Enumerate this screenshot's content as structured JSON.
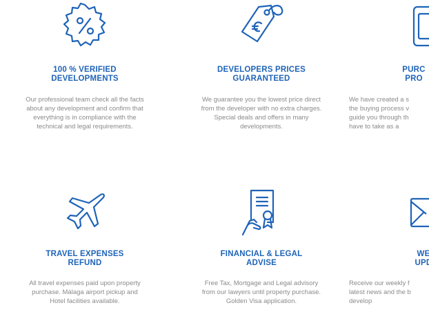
{
  "features": [
    {
      "icon": "percent-badge-icon",
      "title": "100 % VERIFIED\nDEVELOPMENTS",
      "description": "Our professional team check all the facts\nabout any development and confirm that\neverything is in compliance with the\ntechnical  and legal requirements."
    },
    {
      "icon": "euro-price-tag-icon",
      "title": "DEVELOPERS PRICES\nGUARANTEED",
      "description": "We guarantee you the lowest price direct\nfrom the developer with no extra charges.\nSpecial deals and offers in many\ndevelopments."
    },
    {
      "icon": "tablet-icon",
      "title": "PURC\nPRO",
      "description": "We have created a s\nthe buying process v\nguide you through th\nhave to take as a"
    },
    {
      "icon": "airplane-icon",
      "title": "TRAVEL EXPENSES\nREFUND",
      "description": "All travel expenses paid upon property\npurchase. Málaga airport pickup and\nHotel facilities available."
    },
    {
      "icon": "certificate-document-icon",
      "title": "FINANCIAL & LEGAL\nADVISE",
      "description": "Free Tax, Mortgage and Legal advisory\nfrom our lawyers until property purchase.\nGolden Visa application."
    },
    {
      "icon": "envelope-icon",
      "title": "WE\nUPD",
      "description": "Receive our weekly f\nlatest news and the b\ndevelop"
    }
  ],
  "colors": {
    "accent": "#1e63b8",
    "body_text": "#8a8a8a"
  }
}
